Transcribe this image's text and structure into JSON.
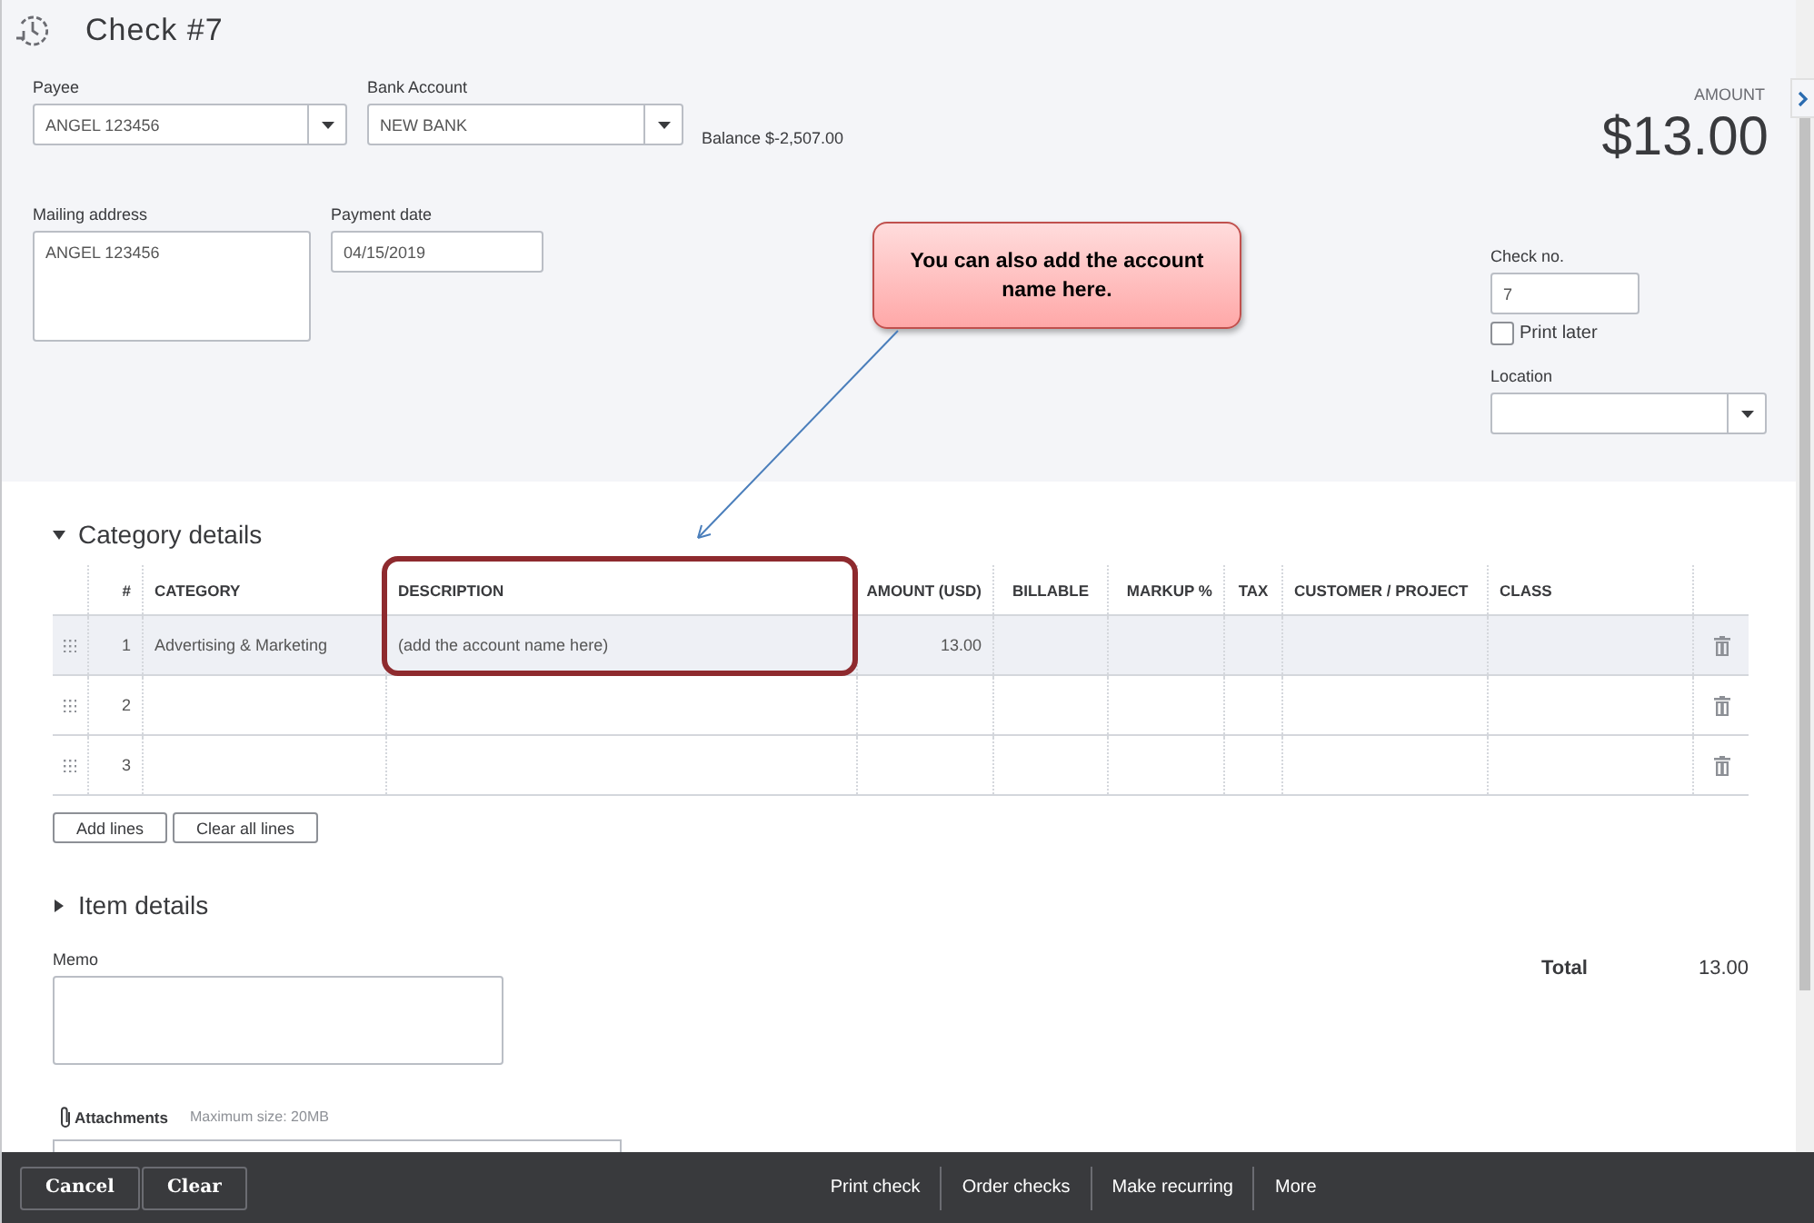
{
  "header": {
    "title": "Check #7"
  },
  "payee": {
    "label": "Payee",
    "value": "ANGEL 123456"
  },
  "bank_account": {
    "label": "Bank Account",
    "value": "NEW BANK",
    "balance": "Balance $-2,507.00"
  },
  "amount": {
    "label": "AMOUNT",
    "value": "$13.00"
  },
  "mailing_address": {
    "label": "Mailing address",
    "value": "ANGEL 123456"
  },
  "payment_date": {
    "label": "Payment date",
    "value": "04/15/2019"
  },
  "check_no": {
    "label": "Check no.",
    "value": "7"
  },
  "print_later": {
    "label": "Print later",
    "checked": false
  },
  "location": {
    "label": "Location"
  },
  "callout": {
    "text": "You can also add the account name here."
  },
  "category_details": {
    "title": "Category details",
    "expanded": true,
    "columns": [
      {
        "label": "#",
        "kind": "number",
        "highlighted": false
      },
      {
        "label": "CATEGORY",
        "kind": "text",
        "highlighted": false
      },
      {
        "label": "DESCRIPTION",
        "kind": "text",
        "highlighted": true
      },
      {
        "label": "AMOUNT (USD)",
        "kind": "number",
        "highlighted": false
      },
      {
        "label": "BILLABLE",
        "kind": "center",
        "highlighted": false
      },
      {
        "label": "MARKUP %",
        "kind": "number",
        "highlighted": false
      },
      {
        "label": "TAX",
        "kind": "center",
        "highlighted": false
      },
      {
        "label": "CUSTOMER / PROJECT",
        "kind": "text",
        "highlighted": false
      },
      {
        "label": "CLASS",
        "kind": "text",
        "highlighted": false
      }
    ],
    "rows": [
      {
        "cells": [
          "1",
          "Advertising & Marketing",
          "(add the account name here)",
          "13.00",
          null,
          null,
          null,
          null,
          null
        ],
        "selected": true
      },
      {
        "cells": [
          "2",
          null,
          null,
          null,
          null,
          null,
          null,
          null,
          null
        ],
        "selected": false
      },
      {
        "cells": [
          "3",
          null,
          null,
          null,
          null,
          null,
          null,
          null,
          null
        ],
        "selected": false
      }
    ],
    "buttons": [
      "Add lines",
      "Clear all lines"
    ]
  },
  "item_details": {
    "title": "Item details",
    "expanded": false
  },
  "memo": {
    "label": "Memo"
  },
  "attachments": {
    "label": "Attachments",
    "hint": "Maximum size: 20MB"
  },
  "total": {
    "label": "Total",
    "value": "13.00"
  },
  "footer": {
    "left_buttons": [
      "Cancel",
      "Clear"
    ],
    "right_actions": [
      "Print check",
      "Order checks",
      "Make recurring",
      "More"
    ]
  }
}
